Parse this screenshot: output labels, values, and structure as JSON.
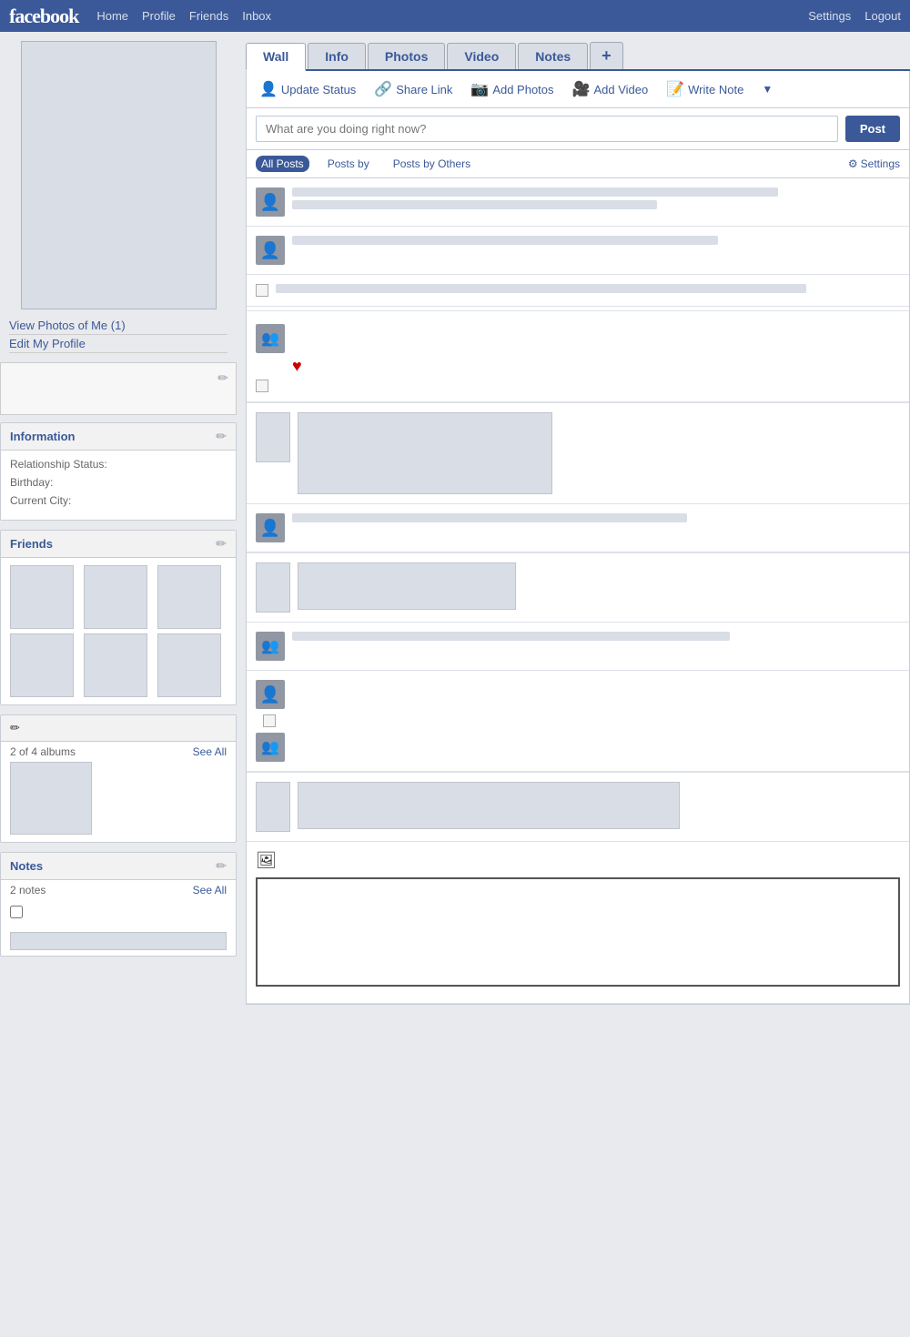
{
  "topnav": {
    "logo": "facebook",
    "links": [
      "Home",
      "Profile",
      "Friends",
      "Inbox"
    ],
    "right_links": [
      "Settings",
      "Logout"
    ]
  },
  "sidebar": {
    "view_photos": "View Photos of Me (1)",
    "edit_profile": "Edit My Profile",
    "information": {
      "title": "Information",
      "relationship_label": "Relationship Status:",
      "birthday_label": "Birthday:",
      "city_label": "Current City:"
    },
    "friends": {
      "title": "Friends"
    },
    "albums": {
      "albums_count": "2 of 4 albums",
      "see_all": "See All"
    },
    "notes": {
      "title": "Notes",
      "count_text": "2 notes",
      "see_all": "See All"
    }
  },
  "tabs": {
    "items": [
      "Wall",
      "Info",
      "Photos",
      "Video",
      "Notes",
      "+"
    ],
    "active": "Wall"
  },
  "actions": {
    "update_status": "Update Status",
    "share_link": "Share Link",
    "add_photos": "Add Photos",
    "add_video": "Add Video",
    "write_note": "Write Note"
  },
  "status_input": {
    "placeholder": "What are you doing right now?",
    "post_button": "Post"
  },
  "filter": {
    "all_posts": "All Posts",
    "posts_by": "Posts by",
    "posts_by_others": "Posts by Others",
    "settings": "Settings"
  }
}
